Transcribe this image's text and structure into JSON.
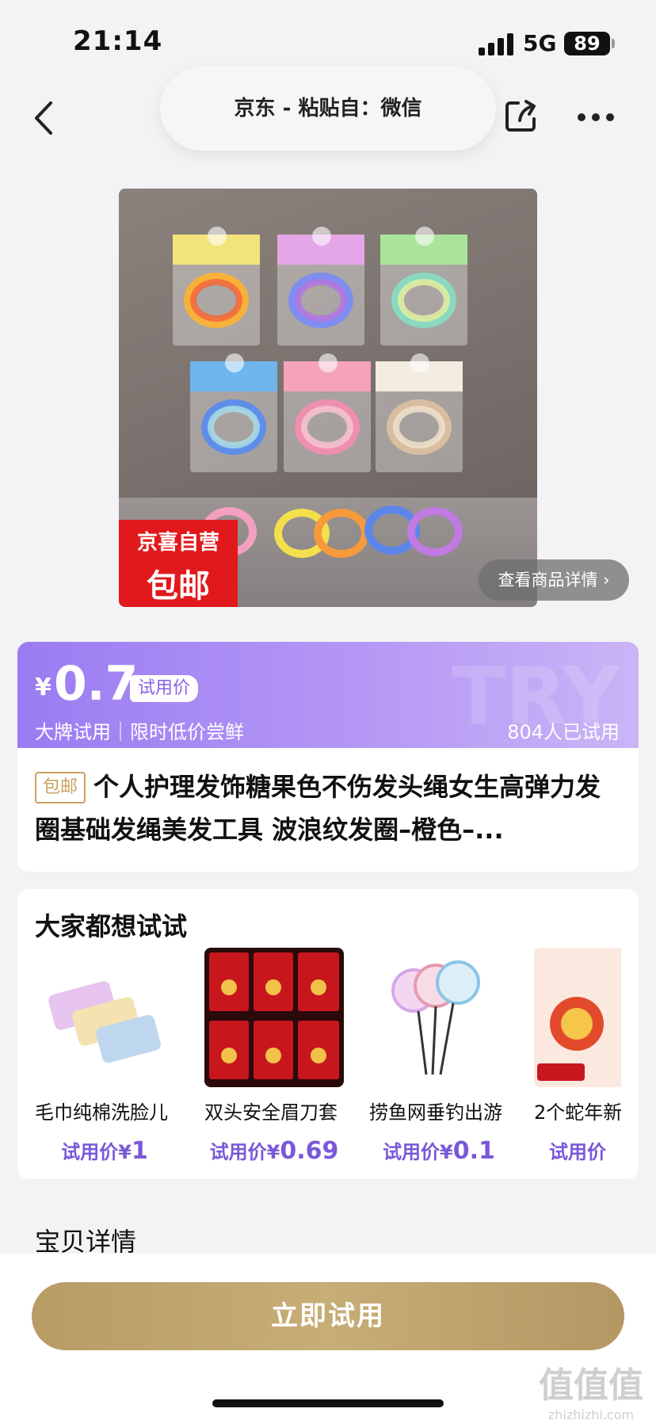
{
  "status_bar": {
    "time": "21:14",
    "network": "5G",
    "battery": "89"
  },
  "nav": {
    "title": "京东 - 粘贴自：微信",
    "icons": [
      "chevron-left-icon",
      "share-icon",
      "more-icon"
    ]
  },
  "product_image": {
    "badge_line1": "京喜自营",
    "badge_line2": "包邮",
    "detail_button": "查看商品详情 ›"
  },
  "price": {
    "currency": "¥",
    "value": "0.7",
    "tag": "试用价",
    "subtitle": "大牌试用｜限时低价尝鲜",
    "tried_count": "804人已试用",
    "bg_text": "TRY"
  },
  "product": {
    "free_shipping_tag": "包邮",
    "title": "个人护理发饰糖果色不伤发头绳女生高弹力发圈基础发绳美发工具 波浪纹发圈–橙色–..."
  },
  "recommendations": {
    "heading": "大家都想试试",
    "items": [
      {
        "name": "毛巾纯棉洗脸儿",
        "price_label": "试用价¥",
        "price": "1"
      },
      {
        "name": "双头安全眉刀套",
        "price_label": "试用价¥",
        "price": "0.69"
      },
      {
        "name": "捞鱼网垂钓出游",
        "price_label": "试用价¥",
        "price": "0.1"
      },
      {
        "name": "2个蛇年新",
        "price_label": "试用价",
        "price": ""
      }
    ]
  },
  "details_heading": "宝贝详情",
  "bottom": {
    "try_button": "立即试用"
  },
  "watermark": {
    "line1": "值值值",
    "line2": "zhizhizhi.com"
  },
  "colors": {
    "accent_purple": "#9a7cf2",
    "price_purple": "#7a58d8",
    "gold": "#c0a46c",
    "badge_red": "#e1191c"
  }
}
